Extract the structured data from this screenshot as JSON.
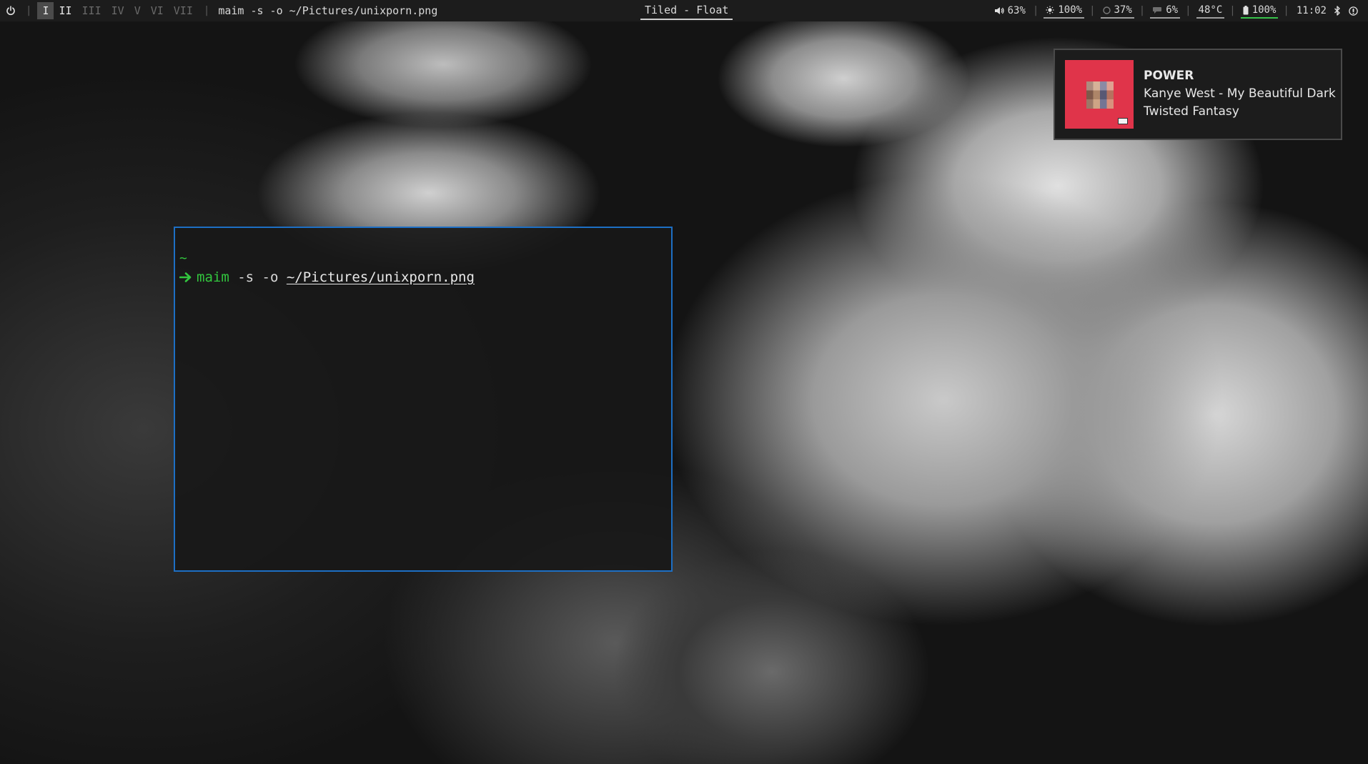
{
  "topbar": {
    "workspaces": [
      {
        "label": "I",
        "state": "active"
      },
      {
        "label": "II",
        "state": "occupied"
      },
      {
        "label": "III",
        "state": "empty"
      },
      {
        "label": "IV",
        "state": "empty"
      },
      {
        "label": "V",
        "state": "empty"
      },
      {
        "label": "VI",
        "state": "empty"
      },
      {
        "label": "VII",
        "state": "empty"
      }
    ],
    "window_title": "maim -s -o ~/Pictures/unixporn.png",
    "layout": "Tiled - Float",
    "modules": {
      "volume": {
        "icon": "volume-icon",
        "value": "63%"
      },
      "brightness": {
        "icon": "brightness-icon",
        "value": "100%"
      },
      "cpu": {
        "icon": "cpu-icon",
        "value": "37%"
      },
      "memory": {
        "icon": "memory-icon",
        "value": "6%"
      },
      "temperature": {
        "value": "48°C"
      },
      "battery": {
        "icon": "battery-icon",
        "value": "100%"
      },
      "clock": {
        "value": "11:02"
      }
    }
  },
  "terminal": {
    "cwd": "~",
    "command": "maim",
    "args": " -s -o ",
    "path": "~/Pictures/unixporn.png"
  },
  "notification": {
    "title": "POWER",
    "body": "Kanye West - My Beautiful Dark Twisted Fantasy"
  },
  "colors": {
    "accent_border": "#1d6fc4",
    "prompt_green": "#32c63e",
    "album_red": "#e0344a",
    "battery_green": "#37c24a"
  }
}
